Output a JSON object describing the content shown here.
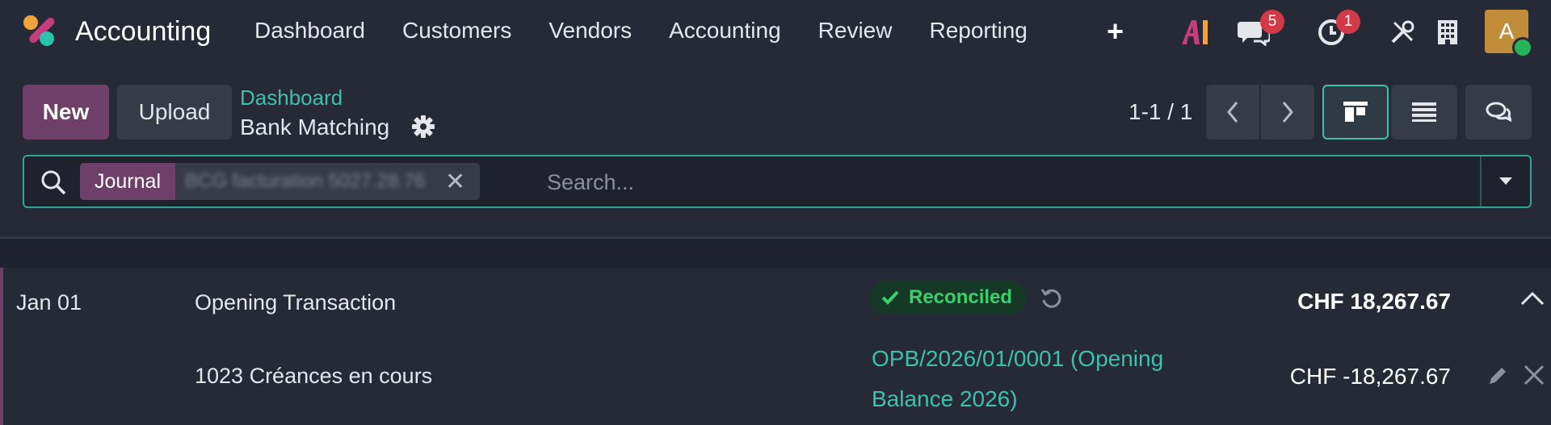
{
  "app": {
    "name": "Accounting"
  },
  "menu": [
    "Dashboard",
    "Customers",
    "Vendors",
    "Accounting",
    "Review",
    "Reporting"
  ],
  "systray": {
    "messages_badge": "5",
    "activities_badge": "1",
    "avatar_initial": "A"
  },
  "control_panel": {
    "new_label": "New",
    "upload_label": "Upload",
    "breadcrumb_parent": "Dashboard",
    "breadcrumb_current": "Bank Matching",
    "pager": "1-1 / 1"
  },
  "search": {
    "facet_label": "Journal",
    "facet_value": "BCG facturation 5027.28.76",
    "placeholder": "Search..."
  },
  "transaction": {
    "date": "Jan 01",
    "label": "Opening Transaction",
    "status": "Reconciled",
    "amount": "CHF 18,267.67",
    "line": {
      "account": "1023 Créances en cours",
      "reference": "OPB/2026/01/0001 (Opening Balance 2026)",
      "amount": "CHF -18,267.67"
    }
  },
  "colors": {
    "background": "#262a36",
    "primary": "#6e3f69",
    "accent": "#3fbfb0",
    "success": "#3ad16d",
    "badge": "#d23a47"
  }
}
